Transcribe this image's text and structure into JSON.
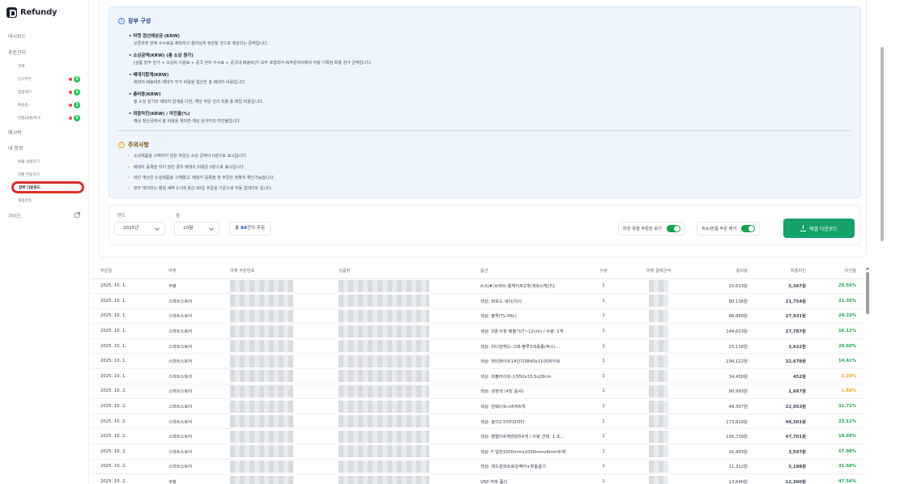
{
  "app": {
    "name": "Refundy"
  },
  "sidebar": {
    "items": [
      {
        "label": "대시보드"
      },
      {
        "label": "주문관리"
      },
      {
        "label": "전체"
      },
      {
        "label": "신규주문",
        "count": "5"
      },
      {
        "label": "발송대기",
        "count": "1"
      },
      {
        "label": "배송중",
        "count": "1"
      },
      {
        "label": "반품/교환/취소",
        "count": "5"
      },
      {
        "label": "매시력"
      },
      {
        "label": "내 정보"
      },
      {
        "label": "환불 설정하기"
      },
      {
        "label": "마켓 연동하기"
      },
      {
        "label": "장부 다운로드"
      },
      {
        "label": "계정관리"
      },
      {
        "label": "가이드"
      }
    ]
  },
  "info": {
    "title": "장부 구성",
    "defs": [
      {
        "term": "• 마켓 정산예상금 (KRW)",
        "desc": "오픈마켓 판매 수수료를 제외하고 셀러님께 정산될 것으로 예상되는 금액입니다."
      },
      {
        "term": "• 소싱금액(KRW) (총 소싱 원가)",
        "desc": "[상품 발주 원가 + 소싱처 이용료 + 중국 현지 수수료 + 중국내 배송비]가 모두 포함되어 AI주문처리에서 자동 기록된 최종 원가 금액입니다."
      },
      {
        "term": "• 배대지합계(KRW)",
        "desc": "배대지 배송비와 배대지 부가 비용을 합산한 총 배대지 비용입니다."
      },
      {
        "term": "• 총비용(KRW)",
        "desc": "총 소싱 원가와 배대지 합계를 더한, 해당 주문 건의 최종 총 매입 비용입니다."
      },
      {
        "term": "• 최종마진(KRW) / 마진율(%)",
        "desc": "예상 정산금에서 총 비용을 제외한 예상 순이익과 마진율입니다."
      }
    ],
    "caution_title": "주의사항",
    "cautions": [
      "소싱제품을 구매하지 않은 주문은 소싱 금액이 0원으로 표시됩니다.",
      "배대지 등록을 하지 않은 경우 배대지 비용은 0원으로 표시됩니다.",
      "마진 계산은 소싱제품을 구매했고, 배대지 등록을 한 주문만 정확히 확인가능합니다.",
      "장부 데이터는 매일 새벽 2시에 최근 90일 주문을 기준으로 자동 업데이트 됩니다."
    ]
  },
  "filter": {
    "year_label": "연도",
    "year_value": "2025년",
    "month_label": "월",
    "month_value": "10월",
    "total_prefix": "총 ",
    "total_count": "84",
    "total_suffix": "건의 주문",
    "toggle1": "마진 유형 주문만 보기",
    "toggle2": "취소/반품 주문 제거",
    "excel_button": "엑셀 다운로드"
  },
  "table": {
    "headers": [
      "주문일",
      "마켓",
      "마켓 주문번호",
      "상품명",
      "옵션",
      "수량",
      "마켓 결제금액",
      "총비용",
      "최종마진",
      "마진율"
    ],
    "rows": [
      [
        "2025. 10. 1.",
        "쿠팡",
        "",
        "",
        "A.5(#)오래쓰-롱케이트2개(계호)(케인다.",
        "1",
        "",
        "15,633원",
        "5,367원",
        "25.56%"
      ],
      [
        "2025. 10. 1.",
        "스마트스토어",
        "",
        "",
        "색상: 퍼포드 새이(직사",
        "1",
        "",
        "80,136원",
        "21,754원",
        "21.35%"
      ],
      [
        "2025. 10. 1.",
        "스마트스토어",
        "",
        "",
        "색상: 블루(TL-06L)",
        "1",
        "",
        "86,889원",
        "27,931원",
        "24.33%"
      ],
      [
        "2025. 10. 1.",
        "스마트스토어",
        "",
        "",
        "색상: 3염 수정 배출기(7~12cm) / 수량: 1개",
        "1",
        "",
        "144,623원",
        "27,787원",
        "16.12%"
      ],
      [
        "2025. 10. 1.",
        "스마트스토어",
        "",
        "",
        "색상: 미디엄케드-그레-블루3색롤종(박스(...",
        "1",
        "",
        "15,118원",
        "3,922원",
        "20.60%"
      ],
      [
        "2025. 10. 1.",
        "스마트스토어",
        "",
        "",
        "색상: 퍼티화이트14인치3840x1100화이트",
        "1",
        "",
        "194,122원",
        "32,678원",
        "14.41%"
      ],
      [
        "2025. 10. 1.",
        "스마트스토어",
        "",
        "",
        "색상: 퍼블라이트-1개50x33.5x28cm",
        "1",
        "",
        "34,458원",
        "452원",
        "1.29%"
      ],
      [
        "2025. 10. 2.",
        "스마트스토어",
        "",
        "",
        "색상: 검정색 (4칭 옵셔)",
        "1",
        "",
        "90,993원",
        "1,667원",
        "1.80%"
      ],
      [
        "2025. 10. 2.",
        "스마트스토어",
        "",
        "",
        "색상: 원웨시트+바퀴6개",
        "1",
        "",
        "49,397원",
        "22,953원",
        "31.72%"
      ],
      [
        "2025. 10. 2.",
        "스마트스토어",
        "",
        "",
        "색상: 높이2.5미터2미터",
        "1",
        "",
        "173,819원",
        "49,301원",
        "22.12%"
      ],
      [
        "2025. 10. 2.",
        "스마트스토어",
        "",
        "",
        "색상: 병렬이4개렌섬미4개 / 수량 선택: 1 조...",
        "1",
        "",
        "195,739원",
        "47,701원",
        "19.59%"
      ],
      [
        "2025. 10. 2.",
        "스마트스토어",
        "",
        "",
        "색상: F 일반1000mmx1000mmx6mm두께",
        "1",
        "",
        "16,403원",
        "3,597원",
        "17.98%"
      ],
      [
        "2025. 10. 2.",
        "스마트스토어",
        "",
        "",
        "색상: 레드원피트로운팩끼+맞춤끌기",
        "1",
        "",
        "11,312원",
        "5,198원",
        "31.48%"
      ],
      [
        "2025. 10. 2.",
        "쿠팡",
        "",
        "",
        "V60 커피 홀더",
        "1",
        "",
        "13,640원",
        "12,360원",
        "47.54%"
      ]
    ]
  },
  "colors": {
    "accent_green": "#16a36a",
    "highlight_red": "#d9302b",
    "info_bg": "#eef5fe"
  }
}
